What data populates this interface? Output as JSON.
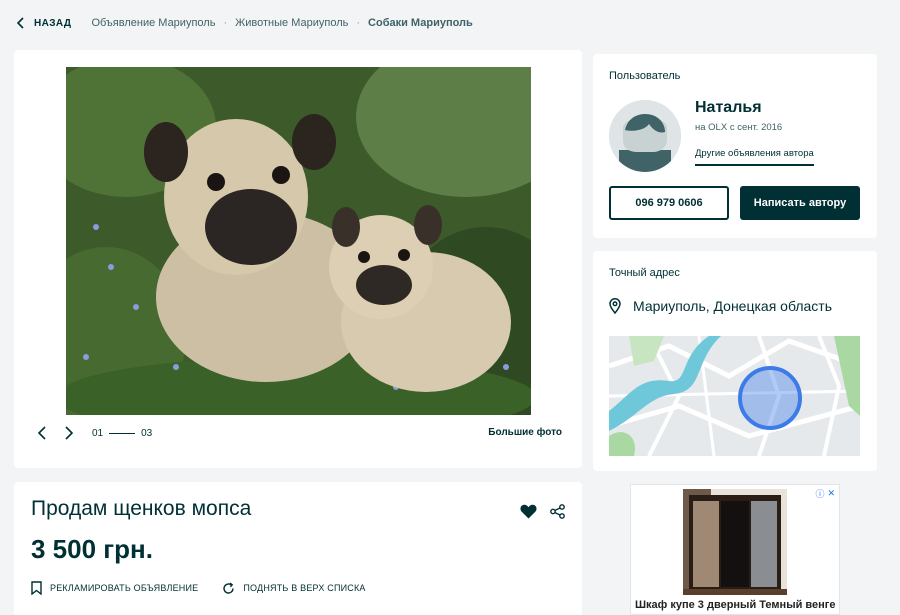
{
  "breadcrumb": {
    "back_label": "НАЗАД",
    "items": [
      "Объявление Мариуполь",
      "Животные Мариуполь",
      "Собаки Мариуполь"
    ]
  },
  "gallery": {
    "page_current": "01",
    "page_total": "03",
    "big_photos_label": "Большие фото"
  },
  "listing": {
    "title": "Продам щенков мопса",
    "price": "3 500 грн.",
    "promote_label": "РЕКЛАМИРОВАТЬ ОБЪЯВЛЕНИЕ",
    "raise_label": "ПОДНЯТЬ В ВЕРХ СПИСКА"
  },
  "user": {
    "section_label": "Пользователь",
    "name": "Наталья",
    "since": "на OLX с сент. 2016",
    "other_ads_label": "Другие объявления автора",
    "phone": "096 979 0606",
    "message_label": "Написать автору"
  },
  "address": {
    "section_label": "Точный адрес",
    "location": "Мариуполь, Донецкая область"
  },
  "ad": {
    "text": "Шкаф купе 3 дверный Темный венге"
  },
  "colors": {
    "primary": "#002f34",
    "background": "#f2f4f5",
    "map_marker": "#3d7be8"
  }
}
